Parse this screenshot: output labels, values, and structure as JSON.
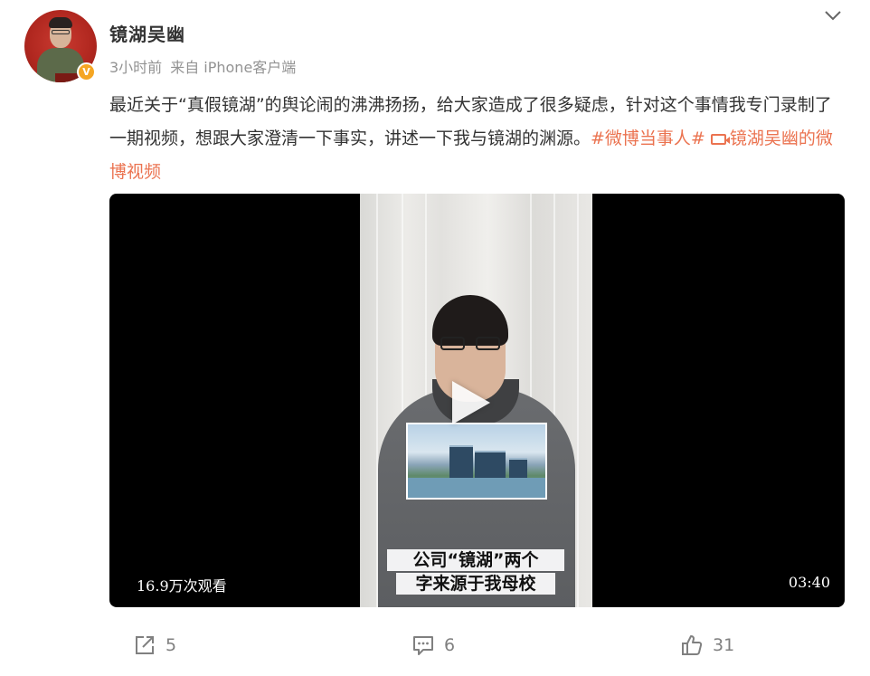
{
  "post": {
    "author": "镜湖吴幽",
    "time": "3小时前",
    "source": "来自 iPhone客户端",
    "verified_badge": "V",
    "text_part1": "最近关于“真假镜湖”的舆论闹的沸沸扬扬，给大家造成了很多疑虑，针对这个事情我专门录制了一期视频，想跟大家澄清一下事实，讲述一下我与镜湖的渊源。",
    "topic": "#微博当事人#",
    "video_link": "镜湖吴幽的微博视频"
  },
  "video": {
    "views": "16.9万次观看",
    "duration": "03:40",
    "subtitle_line1": "公司“镜湖”两个",
    "subtitle_line2": "字来源于我母校"
  },
  "actions": {
    "share_count": "5",
    "comment_count": "6",
    "like_count": "31"
  },
  "icons": {
    "more": "chevron-down-icon",
    "share": "share-icon",
    "comment": "comment-icon",
    "like": "thumbs-up-icon",
    "play": "play-icon",
    "video_link": "video-camera-icon"
  },
  "colors": {
    "topic": "#eb7350",
    "meta": "#939393",
    "badge": "#f5a623"
  }
}
